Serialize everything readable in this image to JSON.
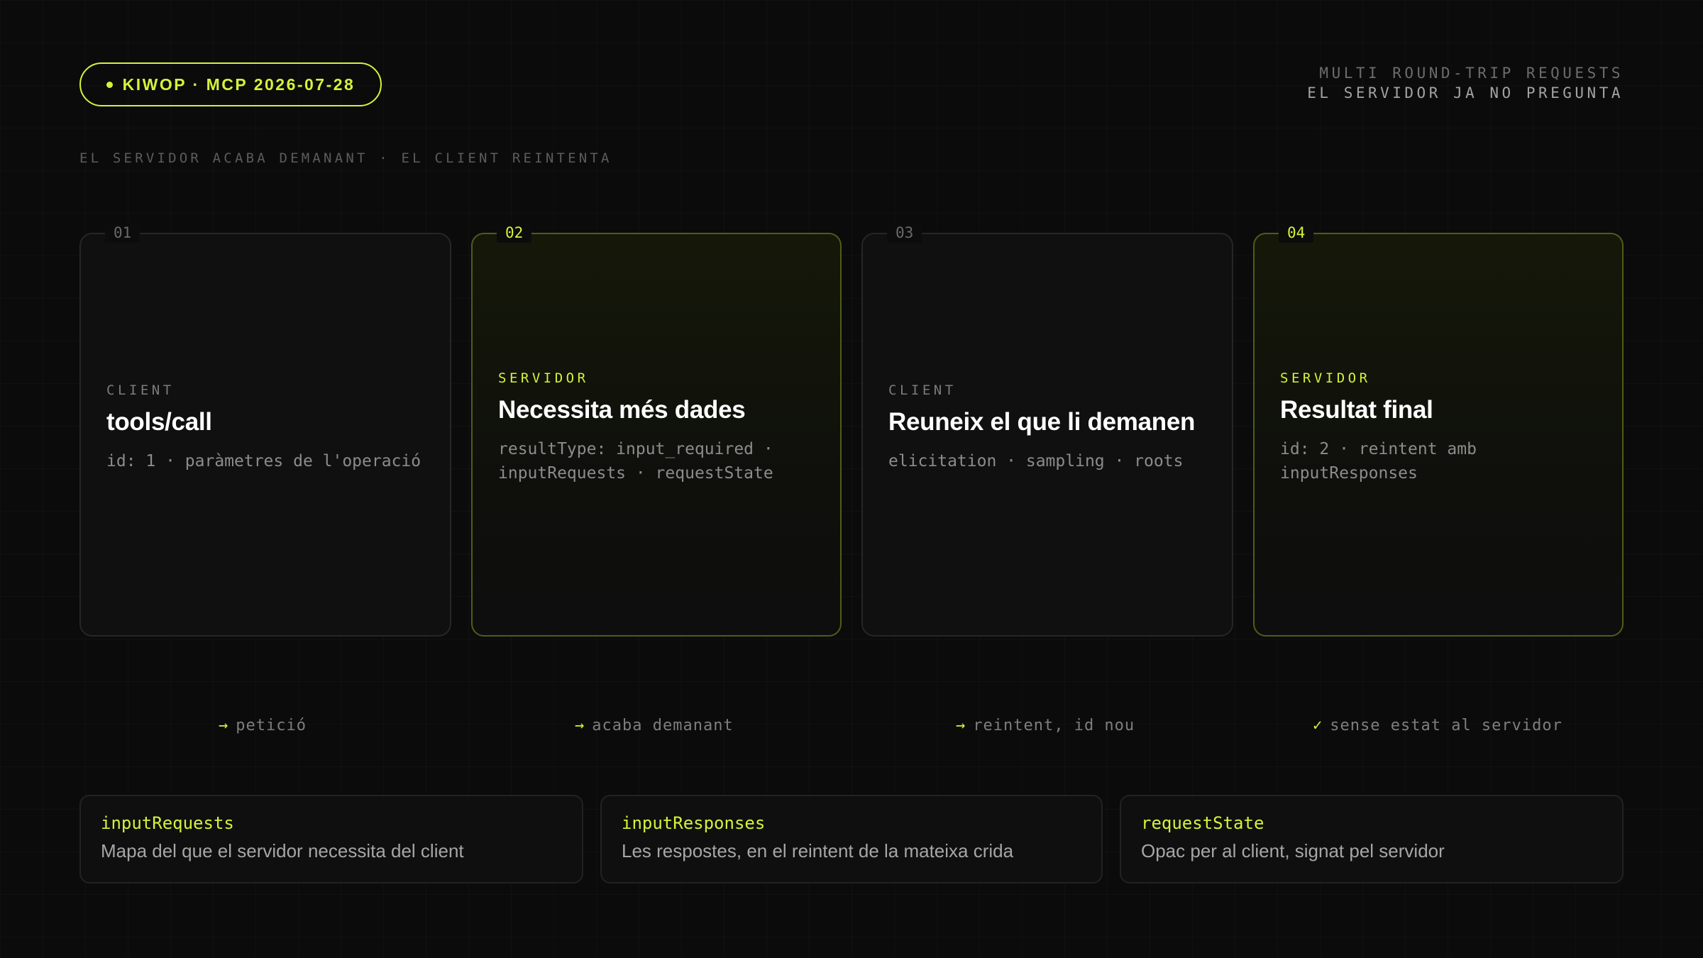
{
  "header": {
    "badge": "KIWOP · MCP 2026-07-28",
    "top_right_line1": "MULTI ROUND-TRIP REQUESTS",
    "top_right_line2": "EL SERVIDOR JA NO PREGUNTA",
    "subtitle": "EL SERVIDOR ACABA DEMANANT · EL CLIENT REINTENTA"
  },
  "steps": [
    {
      "num": "01",
      "role": "CLIENT",
      "title": "tools/call",
      "desc": "id: 1 · paràmetres de l'operació"
    },
    {
      "num": "02",
      "role": "SERVIDOR",
      "title": "Necessita més dades",
      "desc": "resultType: input_required · inputRequests · requestState"
    },
    {
      "num": "03",
      "role": "CLIENT",
      "title": "Reuneix el que li demanen",
      "desc": "elicitation · sampling · roots"
    },
    {
      "num": "04",
      "role": "SERVIDOR",
      "title": "Resultat final",
      "desc": "id: 2 · reintent amb inputResponses"
    }
  ],
  "flow": [
    {
      "symbol": "→",
      "label": "petició"
    },
    {
      "symbol": "→",
      "label": "acaba demanant"
    },
    {
      "symbol": "→",
      "label": "reintent, id nou"
    },
    {
      "symbol": "✓",
      "label": "sense estat al servidor"
    }
  ],
  "fields": [
    {
      "key": "inputRequests",
      "desc": "Mapa del que el servidor necessita del client"
    },
    {
      "key": "inputResponses",
      "desc": "Les respostes, en el reintent de la mateixa crida"
    },
    {
      "key": "requestState",
      "desc": "Opac per al client, signat pel servidor"
    }
  ],
  "colors": {
    "accent": "#d6f23b",
    "background": "#0b0b0b"
  }
}
